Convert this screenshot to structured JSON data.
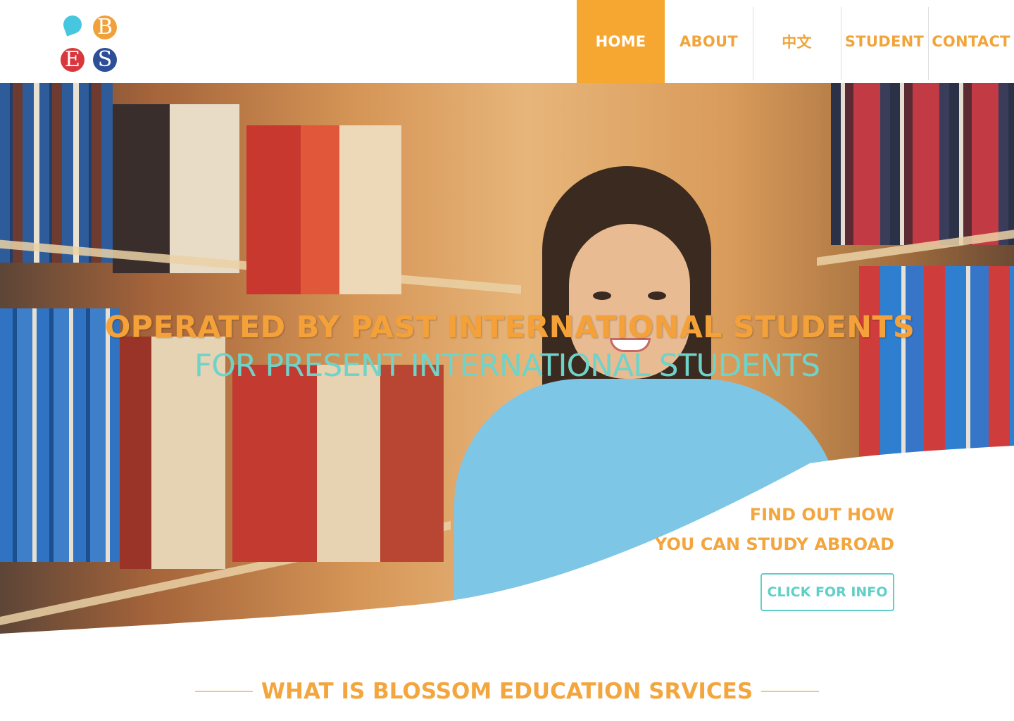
{
  "logo": {
    "letters": [
      "B",
      "E",
      "S"
    ],
    "colors": {
      "drop": "#47c7df",
      "b": "#f0a13b",
      "e": "#d8373d",
      "s": "#2c4f97"
    }
  },
  "nav": {
    "items": [
      {
        "label": "HOME",
        "active": true
      },
      {
        "label": "ABOUT",
        "active": false
      },
      {
        "label": "中文",
        "active": false
      },
      {
        "label": "STUDENT",
        "active": false
      },
      {
        "label": "CONTACT",
        "active": false
      }
    ]
  },
  "hero": {
    "headline_1": "OPERATED BY PAST INTERNATIONAL STUDENTS",
    "headline_2": "FOR PRESENT INTERNATIONAL STUDENTS",
    "cta_line_1": "FIND OUT HOW",
    "cta_line_2": "YOU CAN STUDY ABROAD",
    "cta_button": "CLICK FOR INFO"
  },
  "section": {
    "title": "WHAT IS BLOSSOM EDUCATION SRVICES"
  },
  "colors": {
    "accent_orange": "#f6a732",
    "accent_teal": "#5fcfc7"
  }
}
